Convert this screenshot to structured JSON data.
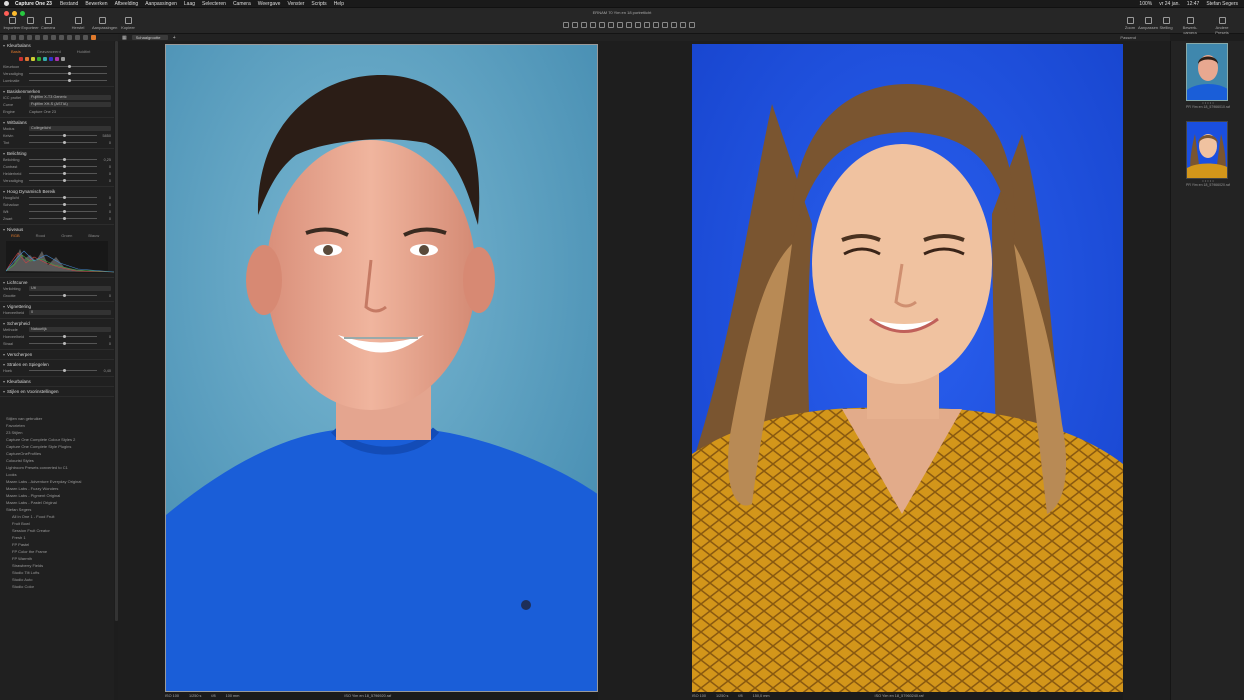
{
  "menubar": {
    "app_name": "Capture One 23",
    "items": [
      "Bestand",
      "Bewerken",
      "Afbeelding",
      "Aanpassingen",
      "Laag",
      "Selecteren",
      "Camera",
      "Weergave",
      "Venster",
      "Scripts",
      "Help"
    ],
    "right": [
      "100%",
      "vr 24 jan.",
      "12:47",
      "Stefan Segers"
    ]
  },
  "toolbar": {
    "doc_title": "ERNAM 70 Yim en 18 portretlicht",
    "left_buttons": [
      "Importeer",
      "Exporteer",
      "Camera",
      "Herstel",
      "Aanpassingen",
      "Kopieer"
    ],
    "cursor_label": "Cursortools",
    "right_buttons": [
      "Zoom",
      "Aanpassen",
      "Stelling",
      "Bewerk-camera",
      "Andere Presets"
    ]
  },
  "viewerbar": {
    "select_value": "Schaalgrootte",
    "right_label": "Passend"
  },
  "left_panel": {
    "tools": [
      {
        "title": "Kleurbalans",
        "tabs": [
          "Basis",
          "Geavanceerd",
          "Huidtint"
        ],
        "rows": [
          {
            "label": "Kleurtoon",
            "value": ""
          },
          {
            "label": "Verzadiging",
            "value": ""
          },
          {
            "label": "Luminatie",
            "value": ""
          }
        ]
      },
      {
        "title": "Basiskenmerken",
        "dropdowns": [
          {
            "label": "ICC profiel",
            "value": "Fujifilm X-T3 Generic"
          },
          {
            "label": "Curve",
            "value": "Fujifilm XH-S (ASTIA)"
          },
          {
            "label": "Engine",
            "value": "Capture One 23"
          }
        ]
      },
      {
        "title": "Witbalans",
        "dropdowns": [
          {
            "label": "Modus",
            "value": "Collegelicht"
          }
        ],
        "rows": [
          {
            "label": "Kelvin",
            "value": "5850"
          },
          {
            "label": "Tint",
            "value": "0"
          }
        ]
      },
      {
        "title": "Belichting",
        "rows": [
          {
            "label": "Belichting",
            "value": "0,25"
          },
          {
            "label": "Contrast",
            "value": "0"
          },
          {
            "label": "Helderheid",
            "value": "0"
          },
          {
            "label": "Verzadiging",
            "value": "0"
          }
        ]
      },
      {
        "title": "Hoog Dynamisch Bereik",
        "rows": [
          {
            "label": "Hooglicht",
            "value": "0"
          },
          {
            "label": "Schaduw",
            "value": "0"
          },
          {
            "label": "Wit",
            "value": "0"
          },
          {
            "label": "Zwart",
            "value": "0"
          }
        ]
      },
      {
        "title": "Niveaus",
        "tabs": [
          "RGB",
          "Rood",
          "Groen",
          "Blauw"
        ]
      },
      {
        "title": "Lichtcurve",
        "dropdowns": [
          {
            "label": "Verlichting",
            "value": "Uit"
          }
        ],
        "rows": [
          {
            "label": "Grootte",
            "value": "0"
          }
        ]
      },
      {
        "title": "Vignettering",
        "dropdowns": [
          {
            "label": "Hoeveelheid",
            "value": "0"
          }
        ]
      },
      {
        "title": "Scherpheid",
        "dropdowns": [
          {
            "label": "Methode",
            "value": "Natuurlijk"
          }
        ],
        "rows": [
          {
            "label": "Hoeveelheid",
            "value": "0"
          },
          {
            "label": "Straal",
            "value": "0"
          }
        ]
      },
      {
        "title": "Verscherpen",
        "rows": []
      },
      {
        "title": "Stralen en Spiegelen",
        "rows": [
          {
            "label": "Hoek",
            "value": "0,40"
          }
        ]
      },
      {
        "title": "Kleurbalans",
        "rows": []
      },
      {
        "title": "Stijlen en Voorinstellingen",
        "rows": []
      }
    ],
    "styles_list": {
      "title": "Stijlen van gebruiker",
      "items": [
        "Favorieten",
        "23 Stijlen",
        "Capture One Complete Colour Styles 2",
        "Capture One Complete Style Plugins",
        "CaptureOneProfiles",
        "Colourist Styles",
        "Lightroom Presets converted to C1",
        "Looks",
        "Maarn Labs - Adventure Everyday Original",
        "Maarn Labs - Fuzzy Wonders",
        "Maarn Labs - Pigment Original",
        "Maarn Labs - Pastel Original",
        "Stefan Segers"
      ],
      "sub_items": [
        "All in One 1 - Food Fruit",
        "Fruit Bowl",
        "Session Fruit Creator",
        "Fresh 1",
        "FP Pastel",
        "FP Color the Frame",
        "FP Warmth",
        "Strawberry Fields",
        "Studio Tilt Lofts",
        "Studio Auto",
        "Studio Color"
      ]
    }
  },
  "viewer": {
    "left_photo": {
      "status_left": "ISO 100",
      "status_mid": "1/250 s",
      "status_mid2": "f/8",
      "status_mid3": "100 mm",
      "filename": "ISO Yim en 18_5796920.raf"
    },
    "right_photo": {
      "status_left": "ISO 100",
      "status_mid": "1/250 s",
      "status_mid2": "f/8",
      "status_mid3": "150,0 mm",
      "filename": "ISO Yim en 18_57960240.raf"
    }
  },
  "browser": {
    "thumbs": [
      {
        "name": "PR Yim en 18_57966010.raf",
        "dots": "• • • • •"
      },
      {
        "name": "PR Yim en 18_57966020.raf",
        "dots": "• • • • •"
      }
    ]
  },
  "colors": {
    "accent": "#e07a2c",
    "bg_left_photo": "#5fa8c8",
    "bg_right_photo": "#1a4fe0",
    "shirt_blue": "#1a5ed8",
    "shirt_mustard": "#d3961a"
  }
}
